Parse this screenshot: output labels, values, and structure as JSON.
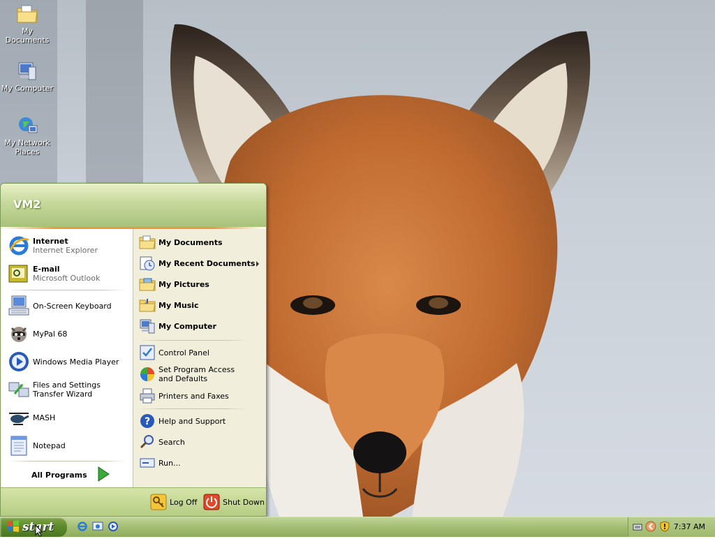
{
  "desktop": {
    "icons": [
      {
        "label": "My Documents"
      },
      {
        "label": "My Computer"
      },
      {
        "label": "My Network Places"
      }
    ]
  },
  "start_menu": {
    "user_name": "VM2",
    "left": {
      "pinned": [
        {
          "title": "Internet",
          "subtitle": "Internet Explorer"
        },
        {
          "title": "E-mail",
          "subtitle": "Microsoft Outlook"
        }
      ],
      "recent": [
        {
          "label": "On-Screen Keyboard"
        },
        {
          "label": "MyPal 68"
        },
        {
          "label": "Windows Media Player"
        },
        {
          "label": "Files and Settings Transfer Wizard"
        },
        {
          "label": "MASH"
        },
        {
          "label": "Notepad"
        }
      ],
      "all_programs": "All Programs"
    },
    "right": {
      "places": [
        {
          "label": "My Documents"
        },
        {
          "label": "My Recent Documents"
        },
        {
          "label": "My Pictures"
        },
        {
          "label": "My Music"
        },
        {
          "label": "My Computer"
        }
      ],
      "settings": [
        {
          "label": "Control Panel"
        },
        {
          "label": "Set Program Access and Defaults"
        },
        {
          "label": "Printers and Faxes"
        }
      ],
      "tools": [
        {
          "label": "Help and Support"
        },
        {
          "label": "Search"
        },
        {
          "label": "Run..."
        }
      ]
    },
    "footer": {
      "log_off": "Log Off",
      "shut_down": "Shut Down"
    }
  },
  "taskbar": {
    "start_label": "start",
    "clock": "7:37 AM"
  },
  "colors": {
    "taskbar_green": "#a4bd74",
    "start_button": "#5b8a2a",
    "right_pane": "#f1efdc"
  }
}
